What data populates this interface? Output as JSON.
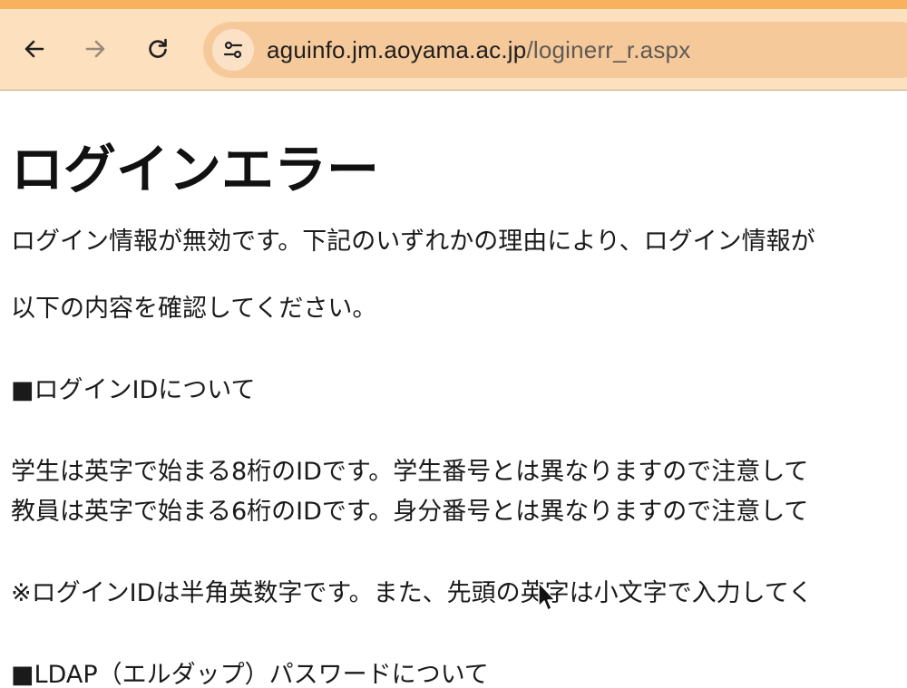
{
  "browser": {
    "url_host": "aguinfo.jm.aoyama.ac.jp",
    "url_path": "/loginerr_r.aspx",
    "icons": {
      "back": "arrow-left-icon",
      "forward": "arrow-right-icon",
      "reload": "reload-icon",
      "site_info": "tune-icon"
    },
    "colors": {
      "toolbar": "#fde0bd",
      "accent_strip": "#f8b15c",
      "omnibox": "#f6c99b"
    }
  },
  "page": {
    "title": "ログインエラー",
    "intro_line1": "ログイン情報が無効です。下記のいずれかの理由により、ログイン情報が",
    "intro_line2": "以下の内容を確認してください。",
    "section1_heading": "■ログインIDについて",
    "student_id_note": "学生は英字で始まる8桁のIDです。学生番号とは異なりますので注意して",
    "faculty_id_note": "教員は英字で始まる6桁のIDです。身分番号とは異なりますので注意して",
    "login_id_format_note": "※ログインIDは半角英数字です。また、先頭の英字は小文字で入力してく",
    "section2_heading": "■LDAP（エルダップ）パスワードについて"
  }
}
